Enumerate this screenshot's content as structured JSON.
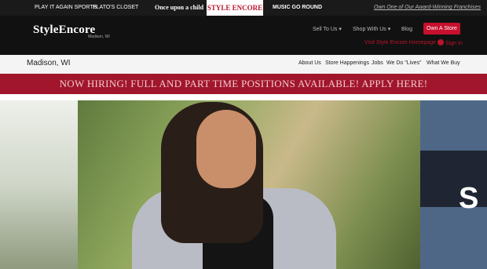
{
  "brands": [
    {
      "label": "PLAY IT AGAIN SPORTS"
    },
    {
      "label": "PLATO'S CLOSET"
    },
    {
      "label": "Once upon a child"
    },
    {
      "label": "STYLE ENCORE"
    },
    {
      "label": "MUSIC GO ROUND"
    }
  ],
  "franchise_link": "Own One of Our Award-Winning Franchises",
  "header": {
    "logo": "StyleEncore",
    "logo_sub": "Madison, WI",
    "nav": [
      "Sell To Us ▾",
      "Shop With Us ▾",
      "Blog"
    ],
    "cta": "Own A Store"
  },
  "location": {
    "title": "Madison, WI",
    "visit": "Visit Style Encore Homepage",
    "signin": "Sign In",
    "subnav": [
      "About Us",
      "Store Happenings",
      "Jobs",
      "We Do \"Lives\"",
      "What We Buy"
    ]
  },
  "banner": "NOW HIRING! FULL AND PART TIME POSITIONS AVAILABLE! APPLY HERE!",
  "hero": {
    "side_letter": "S"
  },
  "colors": {
    "brand_red": "#b8142c",
    "banner_red": "#a1162c",
    "header_dark": "#111111"
  }
}
